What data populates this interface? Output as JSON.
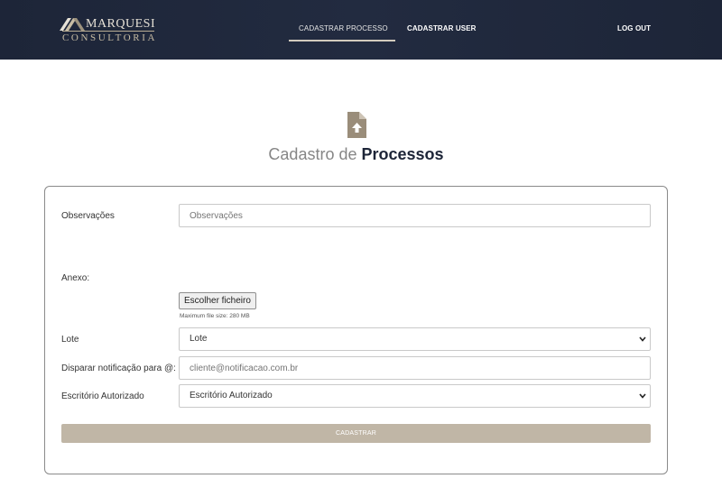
{
  "brand": {
    "name_top": "MARQUESI",
    "name_bottom": "CONSULTORIA",
    "colors": {
      "navbar": "#1d2538",
      "accent": "#c0b6a6",
      "title_strong": "#1d2538"
    }
  },
  "nav": {
    "cadastrar_processo": "CADASTRAR PROCESSO",
    "cadastrar_user": "CADASTRAR USER",
    "logout": "LOG OUT",
    "active": "cadastrar_processo"
  },
  "page": {
    "icon": "file-upload-icon",
    "title_light": "Cadastro de",
    "title_strong": "Processos"
  },
  "form": {
    "observacoes": {
      "label": "Observações",
      "placeholder": "Observações"
    },
    "anexo": {
      "label": "Anexo:",
      "button": "Escolher ficheiro",
      "help": "Maximum file size: 280 MB"
    },
    "lote": {
      "label": "Lote",
      "value": "Lote"
    },
    "notificacao": {
      "label": "Disparar notificação para @:",
      "placeholder": "cliente@notificacao.com.br"
    },
    "escritorio": {
      "label": "Escritório Autorizado",
      "value": "Escritório Autorizado"
    },
    "submit": "CADASTRAR"
  }
}
